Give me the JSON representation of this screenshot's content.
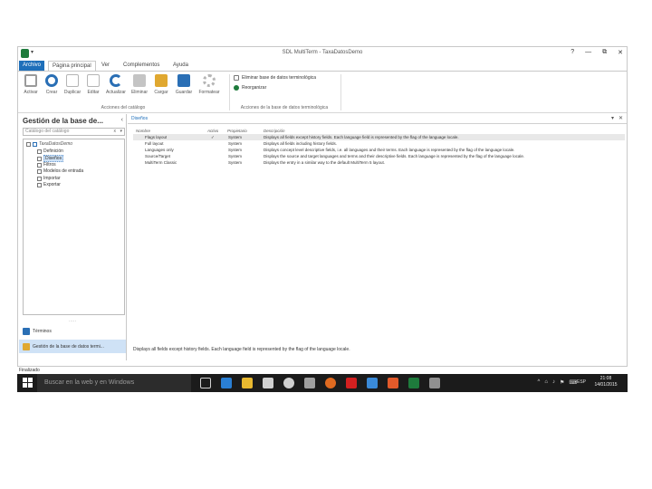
{
  "window": {
    "title": "SDL MultiTerm - TaxaDatosDemo",
    "quick_access": "▾",
    "controls": {
      "help": "?",
      "minimize": "—",
      "restore": "⧉",
      "close": "✕"
    }
  },
  "ribbon_tabs": [
    {
      "label": "Archivo"
    },
    {
      "label": "Página principal"
    },
    {
      "label": "Ver"
    },
    {
      "label": "Complementos"
    },
    {
      "label": "Ayuda"
    }
  ],
  "ribbon": {
    "buttons": [
      {
        "label": "Activar",
        "icon": "check-icon",
        "color": "#9a9a9a"
      },
      {
        "label": "Crear",
        "icon": "add-circle-icon",
        "color": "#2a6fb5"
      },
      {
        "label": "Duplicar",
        "icon": "copy-icon",
        "color": "#b5b5b5"
      },
      {
        "label": "Editar",
        "icon": "edit-icon",
        "color": "#b5b5b5"
      },
      {
        "label": "Actualizar",
        "icon": "refresh-icon",
        "color": "#2a6fb5"
      },
      {
        "label": "Eliminar",
        "icon": "delete-icon",
        "color": "#b5b5b5"
      },
      {
        "label": "Cargar",
        "icon": "open-folder-icon",
        "color": "#e0a830"
      },
      {
        "label": "Guardar",
        "icon": "save-icon",
        "color": "#2a6fb5"
      },
      {
        "label": "Formatear",
        "icon": "gear-icon",
        "color": "#b5b5b5"
      }
    ],
    "group1_label": "Acciones del catálogo",
    "group2": {
      "item1": "Eliminar base de datos terminológica",
      "item2": "Reorganizar",
      "label": "Acciones de la base de datos terminológica"
    }
  },
  "left_panel": {
    "title": "Gestión de la base de...",
    "collapse": "‹",
    "search_placeholder": "Catálogo del catálogo",
    "search_clear": "x",
    "search_arrow": "▾",
    "tree": {
      "root": "TaxaDatosDemo",
      "children": [
        {
          "label": "Definición",
          "icon": "definition-icon",
          "selected": false
        },
        {
          "label": "Diseños",
          "icon": "layout-icon",
          "selected": true
        },
        {
          "label": "Filtros",
          "icon": "filter-icon",
          "selected": false
        },
        {
          "label": "Modelos de entrada",
          "icon": "input-model-icon",
          "selected": false
        },
        {
          "label": "Importar",
          "icon": "import-icon",
          "selected": false
        },
        {
          "label": "Exportar",
          "icon": "export-icon",
          "selected": false
        }
      ]
    },
    "grip": "·····",
    "nav": [
      {
        "label": "Términos",
        "icon": "terms-icon",
        "color": "#2a6fb5",
        "active": false
      },
      {
        "label": "Gestión de la base de datos termi...",
        "icon": "termbase-admin-icon",
        "color": "#e0a830",
        "active": true
      }
    ]
  },
  "content": {
    "tab_label": "Diseños",
    "tab_controls": {
      "dropdown": "▾",
      "close": "✕"
    },
    "columns": [
      "Nombre",
      "Activo",
      "Propietario",
      "Descripción"
    ],
    "rows": [
      {
        "name": "Flags layout",
        "active": "✓",
        "owner": "System",
        "description": "Displays all fields except history fields. Each language field is represented by the flag of the language locale."
      },
      {
        "name": "Full layout",
        "active": "",
        "owner": "System",
        "description": "Displays all fields including history fields."
      },
      {
        "name": "Languages only",
        "active": "",
        "owner": "System",
        "description": "Displays concept level descriptive fields, i.e. all languages and their terms. Each language is represented by the flag of the language locale."
      },
      {
        "name": "Source/Target",
        "active": "",
        "owner": "System",
        "description": "Displays the source and target languages and terms and their descriptive fields. Each language is represented by the flag of the language locale."
      },
      {
        "name": "MultiTerm Classic",
        "active": "",
        "owner": "System",
        "description": "Displays the entry in a similar way to the default MultiTerm 5 layout."
      }
    ],
    "selected_description": "Displays all fields except history fields. Each language field is represented by the flag of the language locale."
  },
  "status_bar": {
    "text": "Finalizado"
  },
  "taskbar": {
    "search_placeholder": "Buscar en la web y en Windows",
    "apps": [
      {
        "icon": "task-view-icon",
        "color": "#d0d0d0"
      },
      {
        "icon": "edge-icon",
        "color": "#2a7fd4"
      },
      {
        "icon": "file-explorer-icon",
        "color": "#e8b830"
      },
      {
        "icon": "store-icon",
        "color": "#d0d0d0"
      },
      {
        "icon": "chrome-icon",
        "color": "#d0d0d0"
      },
      {
        "icon": "media-icon",
        "color": "#a0a0a0"
      },
      {
        "icon": "firefox-icon",
        "color": "#e06a20"
      },
      {
        "icon": "acrobat-icon",
        "color": "#d42020"
      },
      {
        "icon": "photo-icon",
        "color": "#3a8ad8"
      },
      {
        "icon": "office-icon",
        "color": "#e25a2a"
      },
      {
        "icon": "multiterm-icon",
        "color": "#1e7b3c"
      },
      {
        "icon": "tool-icon",
        "color": "#909090"
      }
    ],
    "tray": {
      "chevron": "^",
      "network": "⌂",
      "volume": "♪",
      "flag": "⚑",
      "keyboard": "⌨"
    },
    "language": "ESP",
    "time": "21:08",
    "date": "14/01/2015"
  }
}
